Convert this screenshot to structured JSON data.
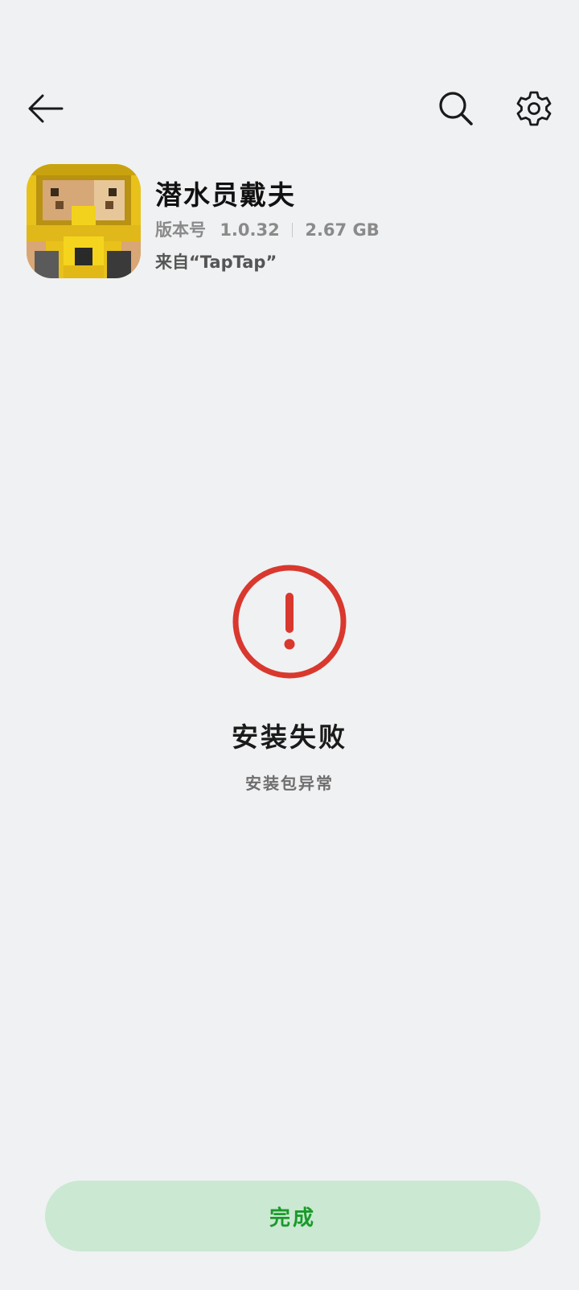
{
  "nav": {
    "back_icon": "arrow-left-icon",
    "search_icon": "search-icon",
    "settings_icon": "gear-icon"
  },
  "app": {
    "name": "潜水员戴夫",
    "version_label": "版本号",
    "version": "1.0.32",
    "size": "2.67 GB",
    "source": "来自“TapTap”"
  },
  "status": {
    "icon": "exclamation-circle-icon",
    "title": "安装失败",
    "subtitle": "安装包异常",
    "color": "#d9382e"
  },
  "actions": {
    "done_label": "完成",
    "done_color": "#1a9a2a",
    "done_bg": "#cae8d2"
  }
}
